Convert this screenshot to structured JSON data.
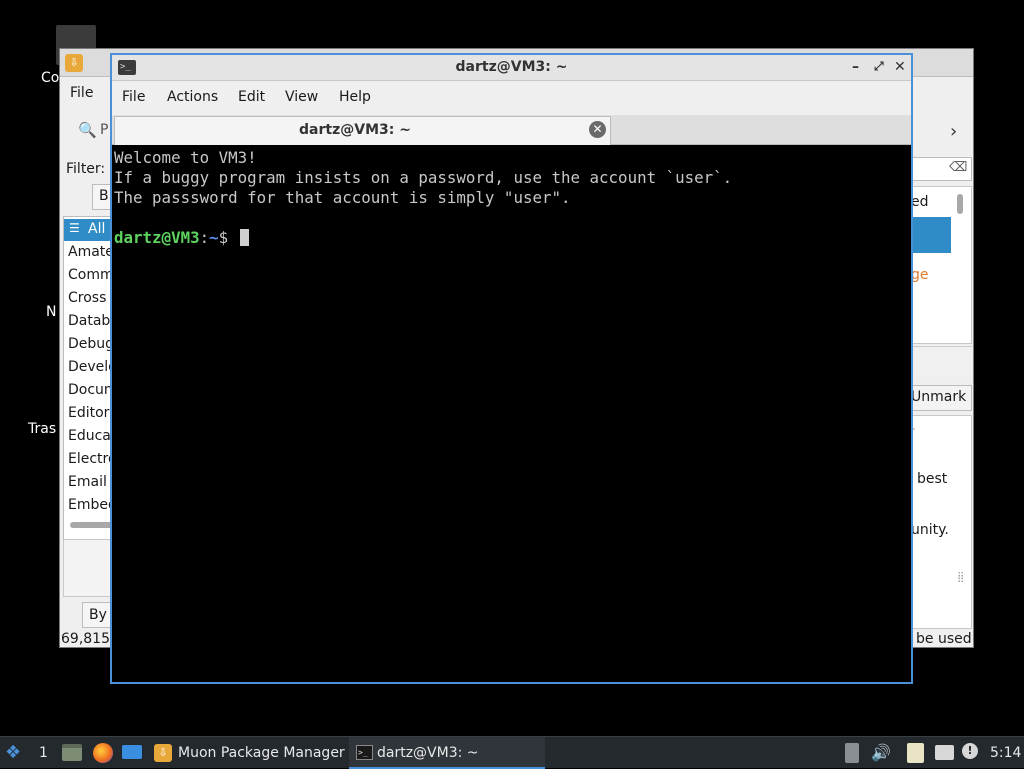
{
  "desktop": {
    "icons": [
      {
        "name": "computer-icon",
        "label": "Co"
      },
      {
        "name": "network-icon",
        "label": "N"
      },
      {
        "name": "trash-icon",
        "label": "Tras"
      }
    ]
  },
  "muon": {
    "menu_file": "File",
    "search_placeholder": "P",
    "filter_label": "Filter:",
    "tab_label": "B",
    "categories": [
      "All",
      "Amate",
      "Comm",
      "Cross I",
      "Databa",
      "Debug",
      "Develo",
      "Docum",
      "Editors",
      "Educat",
      "Electro",
      "Email",
      "Embed"
    ],
    "right_items": {
      "installed": "ed",
      "package": "ge"
    },
    "unmark_label": "Unmark",
    "desc_lines": [
      "-",
      "best",
      "unity."
    ],
    "by_label": "By",
    "count_text": "69,815",
    "status_right": "be used"
  },
  "terminal": {
    "title": "dartz@VM3: ~",
    "menu": [
      "File",
      "Actions",
      "Edit",
      "View",
      "Help"
    ],
    "tab_label": "dartz@VM3: ~",
    "output": [
      "Welcome to VM3!",
      "If a buggy program insists on a password, use the account `user`.",
      "The passsword for that account is simply \"user\"."
    ],
    "prompt_user": "dartz@VM3",
    "prompt_sep": ":",
    "prompt_path": "~",
    "prompt_sign": "$"
  },
  "taskbar": {
    "workspace": "1",
    "tasks": [
      {
        "label": "Muon Package Manager"
      },
      {
        "label": "dartz@VM3: ~"
      }
    ],
    "clock": "5:14"
  },
  "colors": {
    "accent": "#4a90d9",
    "selection": "#308cc6",
    "prompt_user": "#5ed35e",
    "prompt_path": "#5c8eea",
    "taskbar_bg": "#24292e"
  }
}
